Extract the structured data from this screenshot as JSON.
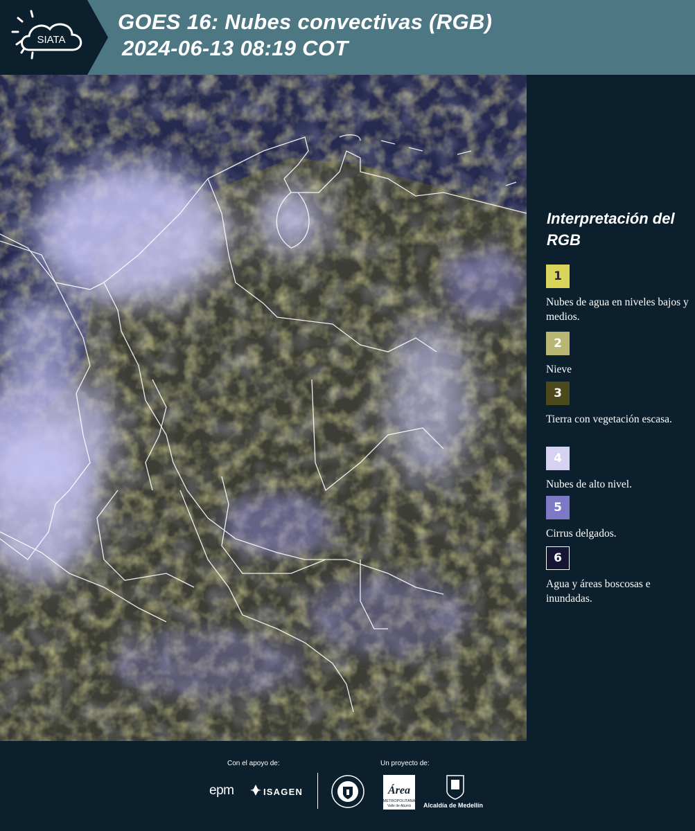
{
  "header": {
    "logo_text": "SIATA",
    "title": "GOES 16: Nubes convectivas (RGB)",
    "timestamp": "2024-06-13 08:19 COT"
  },
  "legend": {
    "title": "Interpretación del RGB",
    "items": [
      {
        "number": "1",
        "color": "#d9d45a",
        "text_color": "#2a2a2a",
        "border": "none",
        "description": "Nubes de agua en niveles bajos y medios."
      },
      {
        "number": "2",
        "color": "#b9b673",
        "text_color": "#ffffff",
        "border": "none",
        "description": "Nieve"
      },
      {
        "number": "3",
        "color": "#4c4a1c",
        "text_color": "#ffffff",
        "border": "none",
        "description": "Tierra con vegetación escasa."
      },
      {
        "number": "4",
        "color": "#d6d3f2",
        "text_color": "#ffffff",
        "border": "none",
        "description": "Nubes de alto nivel."
      },
      {
        "number": "5",
        "color": "#7e79c4",
        "text_color": "#ffffff",
        "border": "none",
        "description": "Cirrus delgados."
      },
      {
        "number": "6",
        "color": "#141634",
        "text_color": "#ffffff",
        "border": "#ffffff",
        "description": "Agua y áreas boscosas e inundadas."
      }
    ]
  },
  "footer": {
    "support_label": "Con el apoyo de:",
    "project_label": "Un proyecto de:",
    "sponsors": {
      "epm": "epm",
      "isagen": "ISAGEN",
      "metropolitana": "Área",
      "metropolitana_sub": "METROPOLITANA",
      "metropolitana_sub2": "Valle de Aburrá",
      "alcaldia": "Alcaldía de Medellín"
    }
  },
  "colors": {
    "header_bg": "#4e7784",
    "logo_bg": "#0b1f2c",
    "page_bg": "#0b1f2c"
  }
}
